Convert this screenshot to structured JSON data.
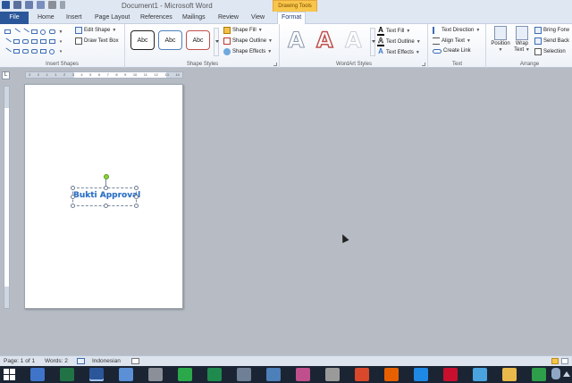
{
  "window": {
    "title": "Document1 - Microsoft Word",
    "contextual_tab": "Drawing Tools"
  },
  "tabs": [
    {
      "label": "File",
      "active": false
    },
    {
      "label": "Home",
      "active": false
    },
    {
      "label": "Insert",
      "active": false
    },
    {
      "label": "Page Layout",
      "active": false
    },
    {
      "label": "References",
      "active": false
    },
    {
      "label": "Mailings",
      "active": false
    },
    {
      "label": "Review",
      "active": false
    },
    {
      "label": "View",
      "active": false
    },
    {
      "label": "Format",
      "active": true
    }
  ],
  "ribbon": {
    "insert_shapes": {
      "label": "Insert Shapes",
      "edit_shape": "Edit Shape",
      "draw_text_box": "Draw Text Box"
    },
    "shape_styles": {
      "label": "Shape Styles",
      "swatches": [
        "Abc",
        "Abc",
        "Abc"
      ],
      "shape_fill": "Shape Fill",
      "shape_outline": "Shape Outline",
      "shape_effects": "Shape Effects"
    },
    "wordart_styles": {
      "label": "WordArt Styles",
      "samples": [
        "A",
        "A",
        "A"
      ],
      "text_fill": "Text Fill",
      "text_outline": "Text Outline",
      "text_effects": "Text Effects"
    },
    "text": {
      "label": "Text",
      "text_direction": "Text Direction",
      "align_text": "Align Text",
      "create_link": "Create Link"
    },
    "arrange": {
      "label": "Arrange",
      "position": "Position",
      "wrap_text_line1": "Wrap",
      "wrap_text_line2": "Text",
      "bring_forward": "Bring Forw",
      "send_backward": "Send Back",
      "selection_pane": "Selection"
    }
  },
  "ruler": {
    "corner": "L",
    "numbers": [
      "3",
      "2",
      "1",
      "1",
      "2",
      "3",
      "4",
      "5",
      "6",
      "7",
      "8",
      "9",
      "10",
      "11",
      "12",
      "13",
      "14"
    ]
  },
  "document": {
    "wordart_text": "Bukti Approval"
  },
  "status": {
    "page": "Page: 1 of 1",
    "words": "Words: 2",
    "language": "Indonesian"
  },
  "taskbar": {
    "apps": [
      {
        "name": "windows-explorer-app",
        "color": "#3f74c9"
      },
      {
        "name": "excel-app",
        "color": "#217346"
      },
      {
        "name": "word-app",
        "color": "#2b579a",
        "active": true
      },
      {
        "name": "app-blue-tile",
        "color": "#5b8fd6"
      },
      {
        "name": "app-gray",
        "color": "#8a8f98"
      },
      {
        "name": "camtasia-app",
        "color": "#2aa84a"
      },
      {
        "name": "app-green-frame",
        "color": "#1f8a4d"
      },
      {
        "name": "app-slate",
        "color": "#6f7f95"
      },
      {
        "name": "app-monitor",
        "color": "#4d7fb8"
      },
      {
        "name": "app-colorful",
        "color": "#c04f8d"
      },
      {
        "name": "app-chess",
        "color": "#9a9a9a"
      },
      {
        "name": "chrome-app",
        "color": "#d9482b"
      },
      {
        "name": "firefox-app",
        "color": "#e66000"
      },
      {
        "name": "internet-explorer-app",
        "color": "#1e88e5"
      },
      {
        "name": "opera-app",
        "color": "#c8102e"
      },
      {
        "name": "app-photos",
        "color": "#4aa3df"
      },
      {
        "name": "file-explorer-app",
        "color": "#e8b84a"
      },
      {
        "name": "camtasia-recorder-app",
        "color": "#2e9e4a"
      }
    ]
  }
}
